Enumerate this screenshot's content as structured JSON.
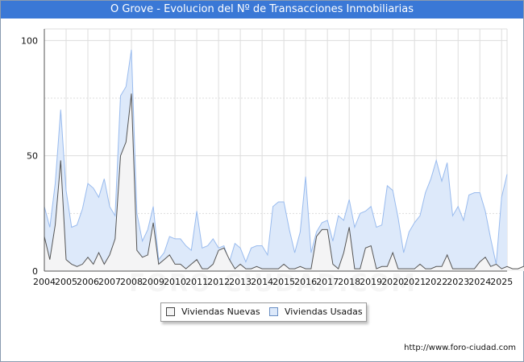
{
  "header": {
    "title": "O Grove - Evolucion del Nº de Transacciones Inmobiliarias"
  },
  "footer": {
    "url": "http://www.foro-ciudad.com"
  },
  "watermark": {
    "text": "FORO-CIUDAD.COM"
  },
  "colors": {
    "title_bg": "#3a78d6",
    "nuevas_fill": "#f4f4f4",
    "nuevas_line": "#555555",
    "usadas_fill": "#dde9fa",
    "usadas_line": "#99bbee",
    "grid": "#dddddd"
  },
  "chart_data": {
    "type": "area",
    "title": "O Grove - Evolucion del Nº de Transacciones Inmobiliarias",
    "xlabel": "",
    "ylabel": "",
    "x_ticks": [
      "2004",
      "2005",
      "2006",
      "2007",
      "2008",
      "2009",
      "2010",
      "2011",
      "2012",
      "2013",
      "2014",
      "2015",
      "2016",
      "2017",
      "2018",
      "2019",
      "2020",
      "2021",
      "2022",
      "2023",
      "2024",
      "2025"
    ],
    "xlim": [
      2004,
      2025.25
    ],
    "ylim": [
      0,
      105
    ],
    "y_ticks": [
      0,
      50,
      100
    ],
    "grid": true,
    "legend_position": "bottom",
    "x_step": 0.25,
    "series": [
      {
        "name": "Viviendas Nuevas",
        "values": [
          15,
          5,
          20,
          48,
          5,
          3,
          2,
          3,
          6,
          3,
          8,
          3,
          7,
          14,
          50,
          56,
          77,
          9,
          6,
          7,
          21,
          3,
          5,
          7,
          3,
          3,
          1,
          3,
          5,
          1,
          1,
          3,
          9,
          10,
          5,
          1,
          3,
          1,
          1,
          2,
          1,
          1,
          1,
          1,
          3,
          1,
          1,
          2,
          1,
          1,
          15,
          18,
          18,
          3,
          1,
          8,
          19,
          1,
          1,
          10,
          11,
          1,
          2,
          2,
          8,
          1,
          1,
          1,
          1,
          3,
          1,
          1,
          2,
          2,
          7,
          1,
          1,
          1,
          1,
          1,
          4,
          6,
          2,
          3,
          1,
          2,
          1,
          1,
          2,
          2,
          1,
          2,
          2,
          1,
          1
        ]
      },
      {
        "name": "Viviendas Usadas",
        "values": [
          28,
          19,
          38,
          70,
          35,
          19,
          20,
          27,
          38,
          36,
          32,
          40,
          28,
          24,
          76,
          80,
          96,
          25,
          13,
          18,
          28,
          5,
          8,
          15,
          14,
          14,
          11,
          9,
          26,
          10,
          11,
          14,
          10,
          11,
          4,
          12,
          10,
          4,
          10,
          11,
          11,
          7,
          28,
          30,
          30,
          18,
          8,
          17,
          41,
          8,
          17,
          21,
          22,
          13,
          24,
          22,
          31,
          19,
          25,
          26,
          28,
          19,
          20,
          37,
          35,
          23,
          8,
          17,
          21,
          24,
          34,
          40,
          48,
          39,
          47,
          24,
          28,
          22,
          33,
          34,
          34,
          26,
          14,
          3,
          32,
          42
        ]
      }
    ]
  },
  "legend": {
    "items": [
      "Viviendas Nuevas",
      "Viviendas Usadas"
    ]
  }
}
